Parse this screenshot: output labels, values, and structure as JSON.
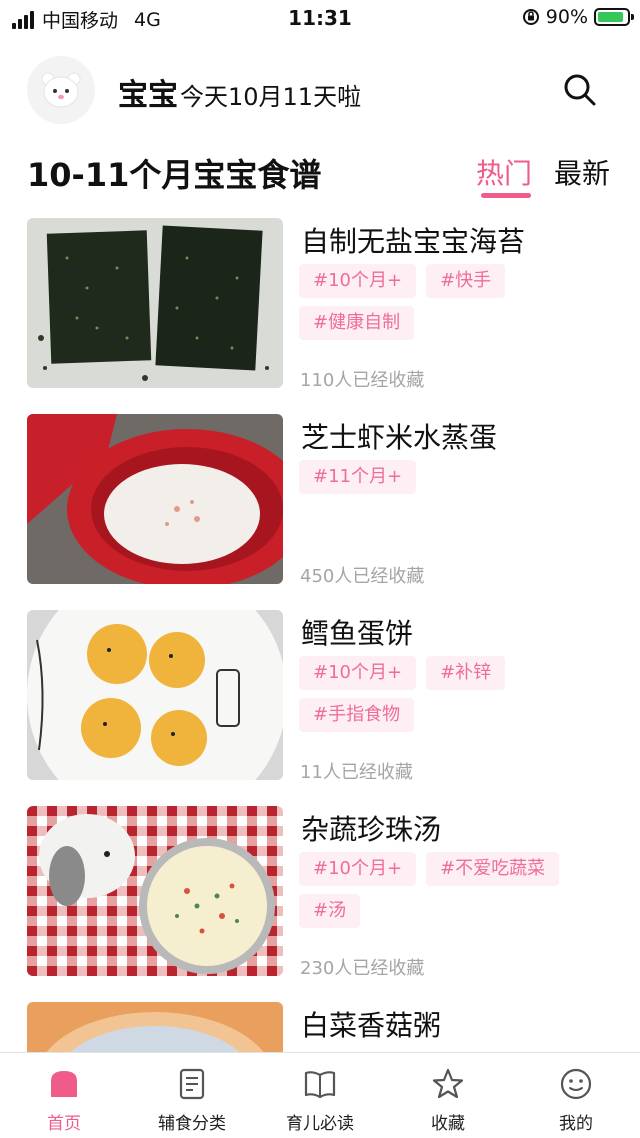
{
  "status_bar": {
    "carrier": "中国移动",
    "network": "4G",
    "time": "11:31",
    "battery": "90%",
    "battery_level": 0.9,
    "icons": [
      "signal-icon",
      "rotation-lock-icon",
      "battery-icon"
    ]
  },
  "header": {
    "baby_name": "宝宝",
    "age_text": "今天10月11天啦",
    "avatar_icon": "baby-face-icon",
    "search_icon": "search-icon"
  },
  "section": {
    "title": "10-11个月宝宝食谱",
    "tabs": [
      {
        "label": "热门",
        "active": true
      },
      {
        "label": "最新",
        "active": false
      }
    ]
  },
  "recipes": [
    {
      "title": "自制无盐宝宝海苔",
      "tags": [
        "#10个月+",
        "#快手",
        "#健康自制"
      ],
      "favorites": "110人已经收藏"
    },
    {
      "title": "芝士虾米水蒸蛋",
      "tags": [
        "#11个月+"
      ],
      "favorites": "450人已经收藏"
    },
    {
      "title": "鳕鱼蛋饼",
      "tags": [
        "#10个月+",
        "#补锌",
        "#手指食物"
      ],
      "favorites": "11人已经收藏"
    },
    {
      "title": "杂蔬珍珠汤",
      "tags": [
        "#10个月+",
        "#不爱吃蔬菜",
        "#汤"
      ],
      "favorites": "230人已经收藏"
    },
    {
      "title": "白菜香菇粥",
      "tags": [],
      "favorites": ""
    }
  ],
  "bottom_nav": [
    {
      "label": "首页",
      "icon": "home-icon",
      "active": true
    },
    {
      "label": "辅食分类",
      "icon": "document-icon",
      "active": false
    },
    {
      "label": "育儿必读",
      "icon": "book-icon",
      "active": false
    },
    {
      "label": "收藏",
      "icon": "star-icon",
      "active": false
    },
    {
      "label": "我的",
      "icon": "smiley-icon",
      "active": false
    }
  ],
  "colors": {
    "accent": "#ef5c8a",
    "tag_bg": "#fdeff3",
    "tag_text": "#ef6e97",
    "muted": "#a5a5a5"
  }
}
